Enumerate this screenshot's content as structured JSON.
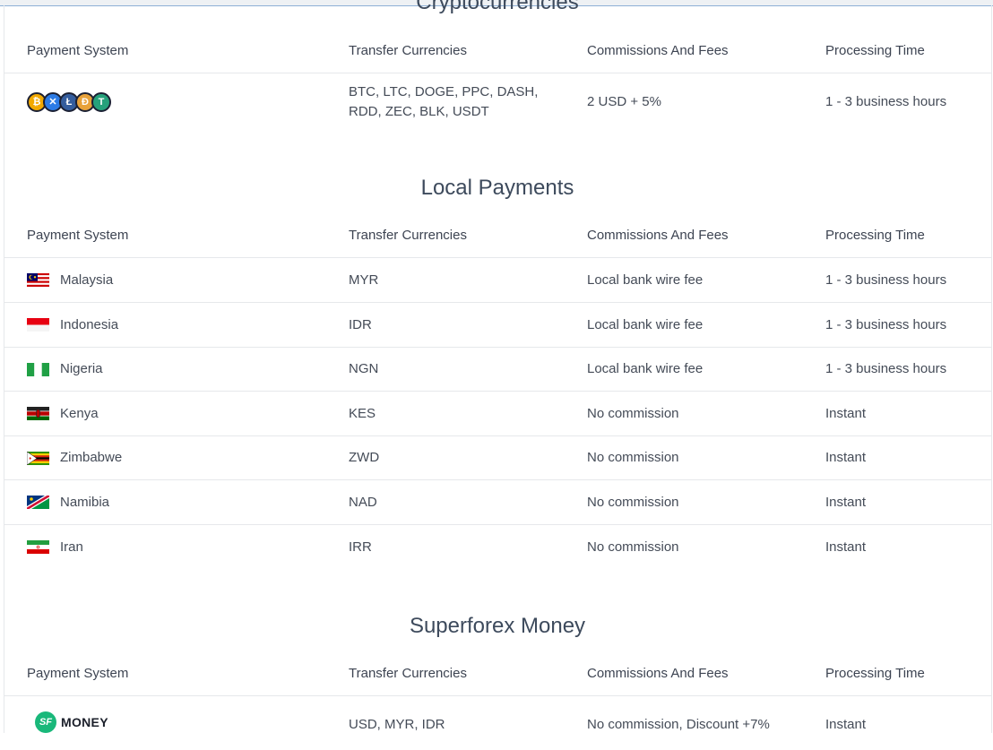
{
  "crypto": {
    "title": "Cryptocurrencies",
    "headers": [
      "Payment System",
      "Transfer Currencies",
      "Commissions And Fees",
      "Processing Time"
    ],
    "row": {
      "currencies": "BTC, LTC, DOGE, PPC, DASH, RDD, ZEC, BLK, USDT",
      "fees": "2 USD + 5%",
      "time": "1 - 3 business hours"
    }
  },
  "local": {
    "title": "Local Payments",
    "headers": [
      "Payment System",
      "Transfer Currencies",
      "Commissions And Fees",
      "Processing Time"
    ],
    "rows": [
      {
        "name": "Malaysia",
        "currency": "MYR",
        "fees": "Local bank wire fee",
        "time": "1 - 3 business hours",
        "flag": "malaysia-flag-icon"
      },
      {
        "name": "Indonesia",
        "currency": "IDR",
        "fees": "Local bank wire fee",
        "time": "1 - 3 business hours",
        "flag": "indonesia-flag-icon"
      },
      {
        "name": "Nigeria",
        "currency": "NGN",
        "fees": "Local bank wire fee",
        "time": "1 - 3 business hours",
        "flag": "nigeria-flag-icon"
      },
      {
        "name": "Kenya",
        "currency": "KES",
        "fees": "No commission",
        "time": "Instant",
        "flag": "kenya-flag-icon"
      },
      {
        "name": "Zimbabwe",
        "currency": "ZWD",
        "fees": "No commission",
        "time": "Instant",
        "flag": "zimbabwe-flag-icon"
      },
      {
        "name": "Namibia",
        "currency": "NAD",
        "fees": "No commission",
        "time": "Instant",
        "flag": "namibia-flag-icon"
      },
      {
        "name": "Iran",
        "currency": "IRR",
        "fees": "No commission",
        "time": "Instant",
        "flag": "iran-flag-icon"
      }
    ]
  },
  "sfmoney": {
    "title": "Superforex Money",
    "headers": [
      "Payment System",
      "Transfer Currencies",
      "Commissions And Fees",
      "Processing Time"
    ],
    "logo_badge": "SF",
    "logo_word": "MONEY",
    "row": {
      "currencies": "USD, MYR, IDR",
      "fees": "No commission, Discount +7%",
      "time": "Instant"
    }
  },
  "colors": {
    "accent_green": "#19b87a",
    "border": "#e6e8eb",
    "text": "#444b57"
  }
}
